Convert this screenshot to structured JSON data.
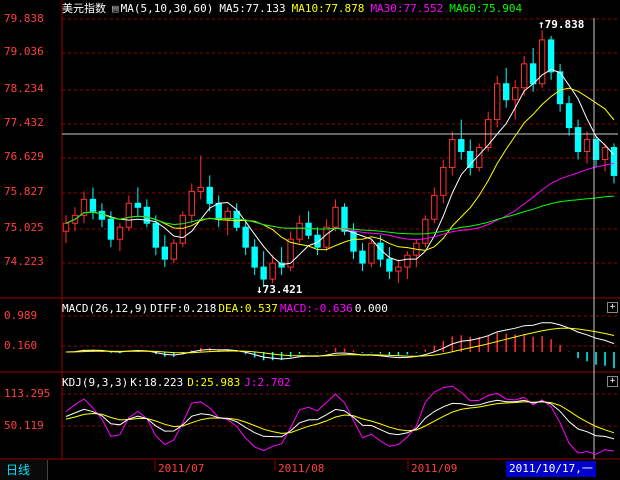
{
  "header": {
    "index_name": "美元指数",
    "ma_label": "MA(5,10,30,60)",
    "ma5": "MA5:77.133",
    "ma10": "MA10:77.878",
    "ma30": "MA30:77.552",
    "ma60": "MA60:75.904"
  },
  "price_axis": [
    "79.838",
    "79.036",
    "78.234",
    "77.432",
    "76.629",
    "75.827",
    "75.025",
    "74.223"
  ],
  "annotations": {
    "high": "79.838",
    "low": "73.421"
  },
  "macd": {
    "label": "MACD(26,12,9)",
    "diff": "DIFF:0.218",
    "dea": "DEA:0.537",
    "macd": "MACD:-0.636",
    "extra": "0.000",
    "axis": [
      "0.989",
      "0.160"
    ]
  },
  "kdj": {
    "label": "KDJ(9,3,3)",
    "k": "K:18.223",
    "d": "D:25.983",
    "j": "J:2.702",
    "axis": [
      "113.295",
      "50.119"
    ]
  },
  "footer": {
    "period_tab": "日线",
    "months": [
      "2011/07",
      "2011/08",
      "2011/09"
    ],
    "cursor_date": "2011/10/17,一"
  },
  "colors": {
    "up": "#ff3030",
    "down": "#00ffff",
    "ma5": "#ffffff",
    "ma10": "#ffff00",
    "ma30": "#ff00ff",
    "ma60": "#00ff00",
    "grid": "#990000"
  },
  "chart_data": {
    "type": "candlestick",
    "ylim": [
      73.2,
      80.2
    ],
    "candles": [
      [
        74.8,
        75.2,
        74.5,
        75.0
      ],
      [
        75.0,
        75.4,
        74.8,
        75.2
      ],
      [
        75.2,
        75.8,
        75.0,
        75.6
      ],
      [
        75.6,
        75.9,
        75.1,
        75.3
      ],
      [
        75.3,
        75.5,
        74.9,
        75.1
      ],
      [
        75.1,
        75.3,
        74.4,
        74.6
      ],
      [
        74.6,
        75.0,
        74.3,
        74.9
      ],
      [
        74.9,
        75.7,
        74.8,
        75.5
      ],
      [
        75.5,
        75.9,
        75.2,
        75.4
      ],
      [
        75.4,
        75.6,
        74.9,
        75.0
      ],
      [
        75.0,
        75.2,
        74.2,
        74.4
      ],
      [
        74.4,
        74.7,
        73.9,
        74.1
      ],
      [
        74.1,
        74.6,
        74.0,
        74.5
      ],
      [
        74.5,
        75.3,
        74.4,
        75.2
      ],
      [
        75.2,
        76.0,
        75.0,
        75.8
      ],
      [
        75.8,
        76.7,
        75.6,
        75.9
      ],
      [
        75.9,
        76.2,
        75.3,
        75.5
      ],
      [
        75.5,
        75.7,
        74.9,
        75.1
      ],
      [
        75.1,
        75.4,
        74.7,
        75.3
      ],
      [
        75.3,
        75.5,
        74.8,
        74.9
      ],
      [
        74.9,
        75.1,
        74.2,
        74.4
      ],
      [
        74.4,
        74.6,
        73.7,
        73.9
      ],
      [
        73.9,
        74.3,
        73.4,
        73.6
      ],
      [
        73.6,
        74.2,
        73.5,
        74.0
      ],
      [
        74.0,
        74.4,
        73.7,
        73.9
      ],
      [
        73.9,
        74.8,
        73.8,
        74.6
      ],
      [
        74.6,
        75.2,
        74.5,
        75.0
      ],
      [
        75.0,
        75.3,
        74.6,
        74.7
      ],
      [
        74.7,
        74.9,
        74.2,
        74.4
      ],
      [
        74.4,
        75.1,
        74.3,
        74.9
      ],
      [
        74.9,
        75.6,
        74.8,
        75.4
      ],
      [
        75.4,
        75.5,
        74.7,
        74.8
      ],
      [
        74.8,
        75.0,
        74.1,
        74.3
      ],
      [
        74.3,
        74.5,
        73.8,
        74.0
      ],
      [
        74.0,
        74.6,
        73.9,
        74.5
      ],
      [
        74.5,
        74.7,
        73.9,
        74.1
      ],
      [
        74.1,
        74.4,
        73.6,
        73.8
      ],
      [
        73.8,
        74.1,
        73.5,
        73.9
      ],
      [
        73.9,
        74.3,
        73.6,
        74.2
      ],
      [
        74.2,
        74.6,
        73.9,
        74.5
      ],
      [
        74.5,
        75.2,
        74.4,
        75.1
      ],
      [
        75.1,
        75.9,
        75.0,
        75.7
      ],
      [
        75.7,
        76.6,
        75.5,
        76.4
      ],
      [
        76.4,
        77.3,
        76.2,
        77.1
      ],
      [
        77.1,
        77.6,
        76.6,
        76.8
      ],
      [
        76.8,
        77.1,
        76.2,
        76.4
      ],
      [
        76.4,
        77.0,
        76.3,
        76.9
      ],
      [
        76.9,
        77.8,
        76.8,
        77.6
      ],
      [
        77.6,
        78.7,
        77.4,
        78.5
      ],
      [
        78.5,
        78.9,
        77.9,
        78.1
      ],
      [
        78.1,
        78.6,
        77.6,
        78.4
      ],
      [
        78.4,
        79.2,
        78.2,
        79.0
      ],
      [
        79.0,
        79.4,
        78.3,
        78.5
      ],
      [
        78.5,
        79.84,
        78.4,
        79.6
      ],
      [
        79.6,
        79.7,
        78.6,
        78.8
      ],
      [
        78.8,
        79.0,
        77.8,
        78.0
      ],
      [
        78.0,
        78.2,
        77.2,
        77.4
      ],
      [
        77.4,
        77.6,
        76.6,
        76.8
      ],
      [
        76.8,
        77.3,
        76.5,
        77.1
      ],
      [
        77.1,
        77.2,
        76.4,
        76.6
      ],
      [
        76.6,
        77.0,
        76.3,
        76.9
      ],
      [
        76.9,
        77.0,
        76.0,
        76.2
      ]
    ]
  }
}
